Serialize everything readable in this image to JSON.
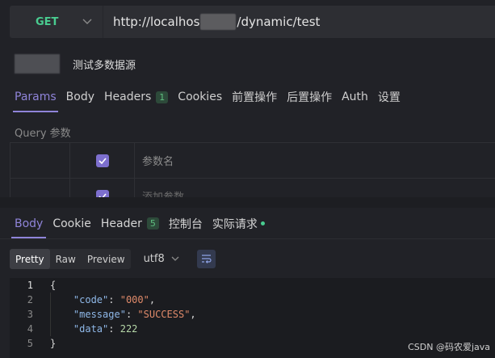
{
  "request": {
    "method": "GET",
    "url_prefix": "http://localhos",
    "url_suffix": "/dynamic/test",
    "name": "测试多数据源"
  },
  "request_tabs": [
    {
      "label": "Params",
      "active": true
    },
    {
      "label": "Body"
    },
    {
      "label": "Headers",
      "badge": "1"
    },
    {
      "label": "Cookies"
    },
    {
      "label": "前置操作"
    },
    {
      "label": "后置操作"
    },
    {
      "label": "Auth"
    },
    {
      "label": "设置"
    }
  ],
  "query": {
    "label": "Query 参数",
    "rows": [
      {
        "placeholder": "参数名"
      },
      {
        "placeholder": "添加参数"
      }
    ]
  },
  "response_tabs": [
    {
      "label": "Body",
      "active": true
    },
    {
      "label": "Cookie"
    },
    {
      "label": "Header",
      "badge": "5"
    },
    {
      "label": "控制台"
    },
    {
      "label": "实际请求",
      "dot": true
    }
  ],
  "view_modes": [
    "Pretty",
    "Raw",
    "Preview"
  ],
  "encoding": "utf8",
  "code_lines": [
    {
      "num": "1"
    },
    {
      "num": "2",
      "key": "\"code\"",
      "value": "\"000\"",
      "vtype": "string",
      "trail": ","
    },
    {
      "num": "3",
      "key": "\"message\"",
      "value": "\"SUCCESS\"",
      "vtype": "string",
      "trail": ","
    },
    {
      "num": "4",
      "key": "\"data\"",
      "value": "222",
      "vtype": "number",
      "trail": ""
    },
    {
      "num": "5"
    }
  ],
  "watermark": "CSDN @码农爱java",
  "colors": {
    "accent": "#8f84d9",
    "get": "#49cc90"
  }
}
